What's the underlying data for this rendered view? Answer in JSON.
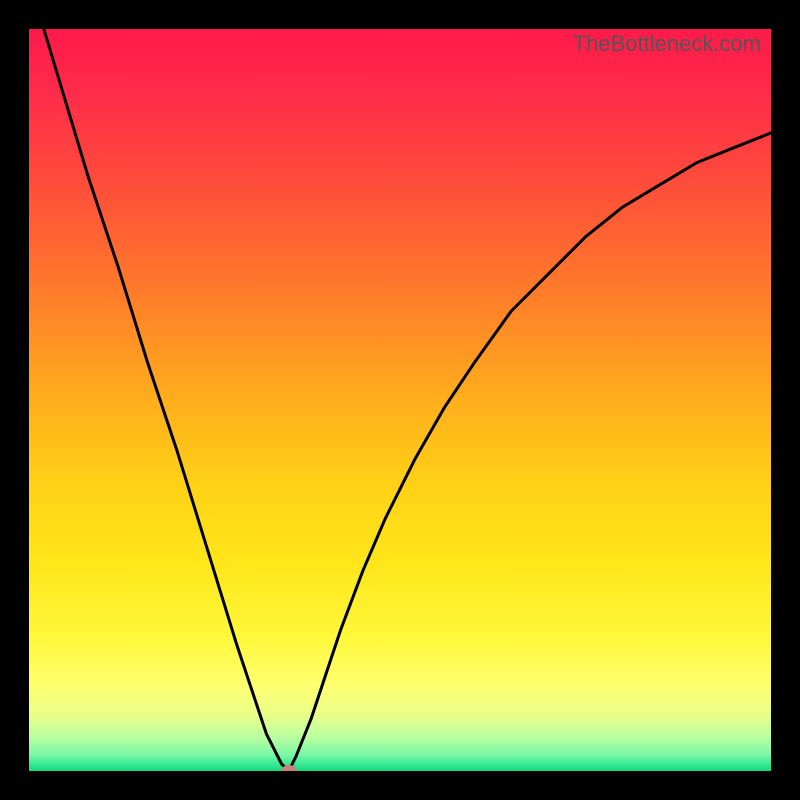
{
  "watermark": "TheBottleneck.com",
  "chart_data": {
    "type": "line",
    "title": "",
    "xlabel": "",
    "ylabel": "",
    "x_range": [
      0,
      100
    ],
    "y_range": [
      0,
      100
    ],
    "series": [
      {
        "name": "curve",
        "x": [
          0,
          2,
          5,
          8,
          12,
          16,
          20,
          24,
          28,
          30,
          32,
          33,
          34,
          35,
          36,
          38,
          40,
          42,
          45,
          48,
          52,
          56,
          60,
          65,
          70,
          75,
          80,
          85,
          90,
          95,
          100
        ],
        "y": [
          108,
          100,
          90,
          80,
          68,
          55,
          43,
          30,
          17,
          11,
          5,
          3,
          1,
          0,
          2,
          7,
          13,
          19,
          27,
          34,
          42,
          49,
          55,
          62,
          67,
          72,
          76,
          79,
          82,
          84,
          86
        ]
      }
    ],
    "marker": {
      "x": 35,
      "y": 0
    },
    "background_gradient": {
      "stops": [
        {
          "pos": 0.0,
          "color": "#ff1a4a"
        },
        {
          "pos": 0.08,
          "color": "#ff2a4a"
        },
        {
          "pos": 0.2,
          "color": "#ff4a3c"
        },
        {
          "pos": 0.35,
          "color": "#ff7a2a"
        },
        {
          "pos": 0.5,
          "color": "#ffae1c"
        },
        {
          "pos": 0.62,
          "color": "#ffd316"
        },
        {
          "pos": 0.72,
          "color": "#ffe61a"
        },
        {
          "pos": 0.82,
          "color": "#fff83a"
        },
        {
          "pos": 0.885,
          "color": "#ffff70"
        },
        {
          "pos": 0.925,
          "color": "#e9ff8a"
        },
        {
          "pos": 0.955,
          "color": "#b8ffa0"
        },
        {
          "pos": 0.978,
          "color": "#7cf7a6"
        },
        {
          "pos": 0.992,
          "color": "#32e892"
        },
        {
          "pos": 1.0,
          "color": "#12d67e"
        }
      ]
    }
  }
}
